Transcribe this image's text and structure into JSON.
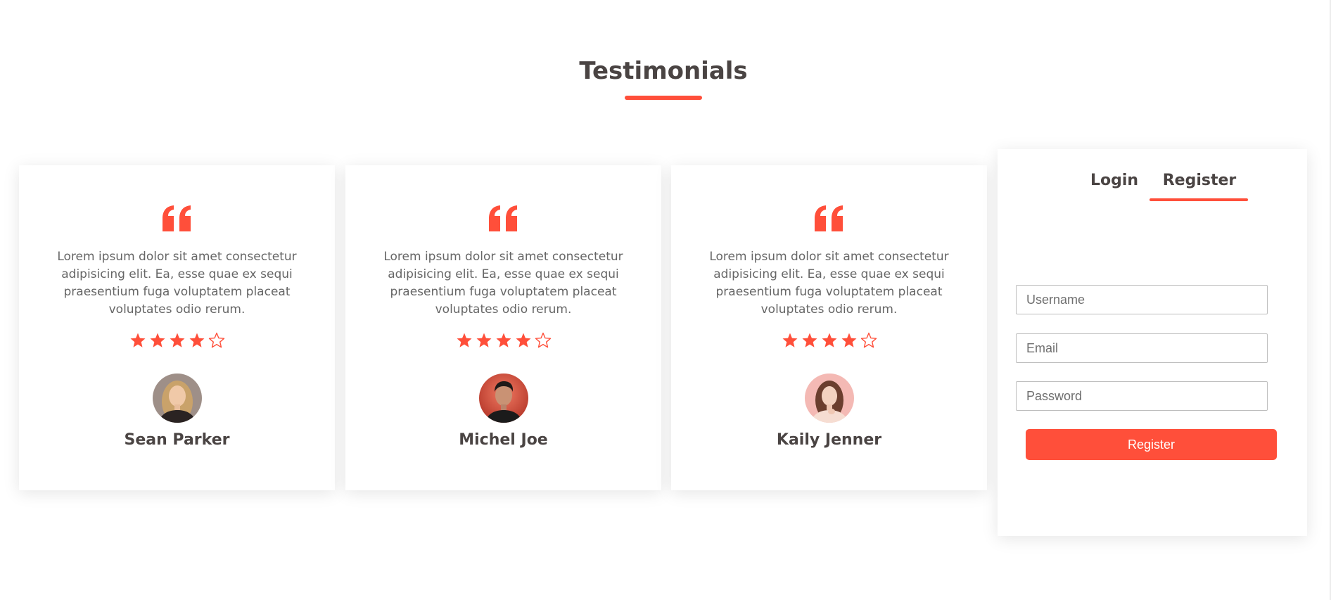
{
  "section": {
    "title": "Testimonials"
  },
  "colors": {
    "accent": "#ff4f3a",
    "heading": "#4a4443",
    "body_text": "#666666"
  },
  "testimonials": [
    {
      "quote_icon": "quote-icon",
      "text": "Lorem ipsum dolor sit amet consectetur adipisicing elit. Ea, esse quae ex sequi praesentium fuga voluptatem placeat voluptates odio rerum.",
      "rating": 4,
      "rating_max": 5,
      "name": "Sean Parker",
      "avatar": "avatar-woman-blonde"
    },
    {
      "quote_icon": "quote-icon",
      "text": "Lorem ipsum dolor sit amet consectetur adipisicing elit. Ea, esse quae ex sequi praesentium fuga voluptatem placeat voluptates odio rerum.",
      "rating": 4,
      "rating_max": 5,
      "name": "Michel Joe",
      "avatar": "avatar-man-dark-hair"
    },
    {
      "quote_icon": "quote-icon",
      "text": "Lorem ipsum dolor sit amet consectetur adipisicing elit. Ea, esse quae ex sequi praesentium fuga voluptatem placeat voluptates odio rerum.",
      "rating": 4,
      "rating_max": 5,
      "name": "Kaily Jenner",
      "avatar": "avatar-woman-brunette"
    }
  ],
  "auth": {
    "tabs": [
      {
        "label": "Login",
        "active": false
      },
      {
        "label": "Register",
        "active": true
      }
    ],
    "fields": {
      "username_placeholder": "Username",
      "email_placeholder": "Email",
      "password_placeholder": "Password"
    },
    "submit_label": "Register"
  }
}
